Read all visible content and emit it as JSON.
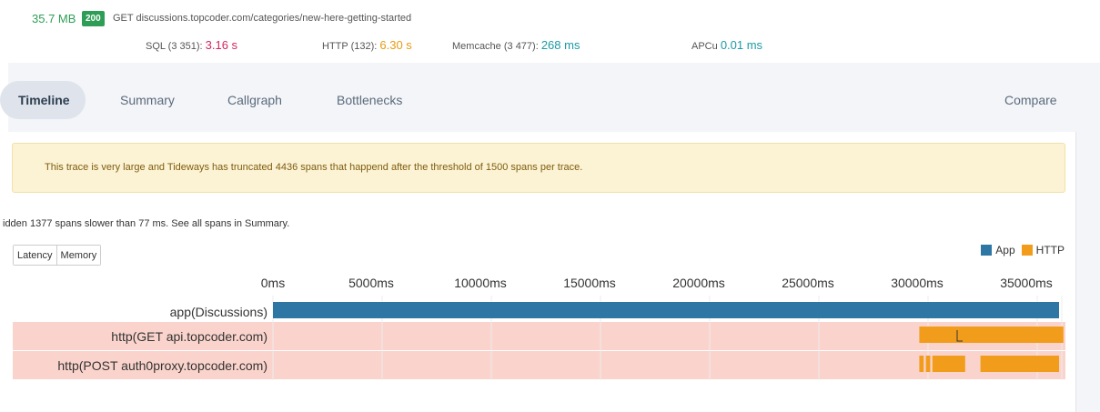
{
  "header": {
    "memory": "35.7 MB",
    "status_code": "200",
    "request": "GET discussions.topcoder.com/categories/new-here-getting-started",
    "stats": {
      "sql_label": "SQL (3 351):",
      "sql_value": "3.16 s",
      "http_label": "HTTP (132):",
      "http_value": "6.30 s",
      "memcache_label": "Memcache (3 477):",
      "memcache_value": "268 ms",
      "apcu_label": "APCu",
      "apcu_value": "0.01 ms"
    }
  },
  "tabs": {
    "timeline": "Timeline",
    "summary": "Summary",
    "callgraph": "Callgraph",
    "bottlenecks": "Bottlenecks",
    "compare": "Compare"
  },
  "alert": "This trace is very large and Tideways has truncated 4436 spans that happend after the threshold of 1500 spans per trace.",
  "hidden_note": "idden 1377 spans slower than 77 ms. See all spans in Summary.",
  "toggle": {
    "latency": "Latency",
    "memory": "Memory"
  },
  "colors": {
    "app": "#2e77a4",
    "http": "#f29c1c",
    "highlight_row": "#fad4cc"
  },
  "chart_data": {
    "type": "bar",
    "x_unit": "ms",
    "xlim": [
      0,
      36000
    ],
    "ticks": [
      "0ms",
      "5000ms",
      "10000ms",
      "15000ms",
      "20000ms",
      "25000ms",
      "30000ms",
      "35000ms"
    ],
    "legend": [
      {
        "name": "App",
        "color": "#2e77a4"
      },
      {
        "name": "HTTP",
        "color": "#f29c1c"
      }
    ],
    "rows": [
      {
        "label": "app(Discussions)",
        "type": "App",
        "highlight": false,
        "spans": [
          [
            0,
            36000
          ]
        ]
      },
      {
        "label": "http(GET api.topcoder.com)",
        "type": "HTTP",
        "highlight": true,
        "spans": [
          [
            29600,
            36200
          ]
        ]
      },
      {
        "label": "http(POST auth0proxy.topcoder.com)",
        "type": "HTTP",
        "highlight": true,
        "spans": [
          [
            29600,
            29800
          ],
          [
            29900,
            30100
          ],
          [
            30200,
            31700
          ],
          [
            32400,
            36000
          ]
        ]
      }
    ]
  }
}
